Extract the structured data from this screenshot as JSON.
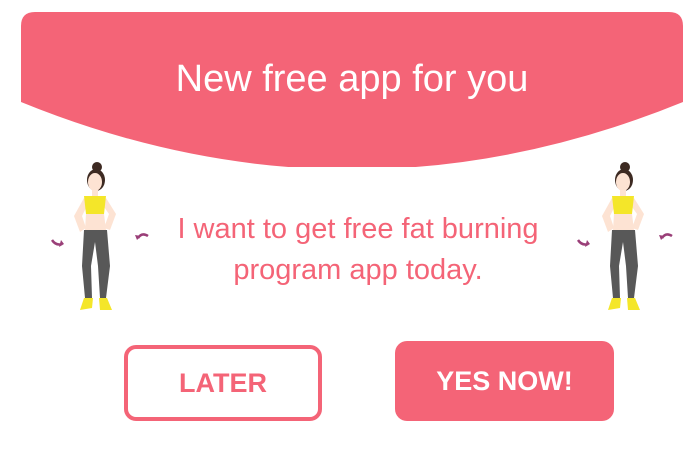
{
  "popup": {
    "title": "New free app for you",
    "message_line1": "I want to get free fat burning",
    "message_line2": "program app today."
  },
  "buttons": {
    "later_label": "LATER",
    "yes_label": "YES NOW!"
  },
  "icons": {
    "left_figure": "woman-hip-rotation-icon",
    "right_figure": "woman-hip-rotation-icon"
  },
  "colors": {
    "accent": "#f46477",
    "skin": "#fde3d3",
    "top": "#f4e629",
    "leggings": "#585858",
    "hair": "#3d2a22",
    "arrow": "#9a3f78"
  }
}
